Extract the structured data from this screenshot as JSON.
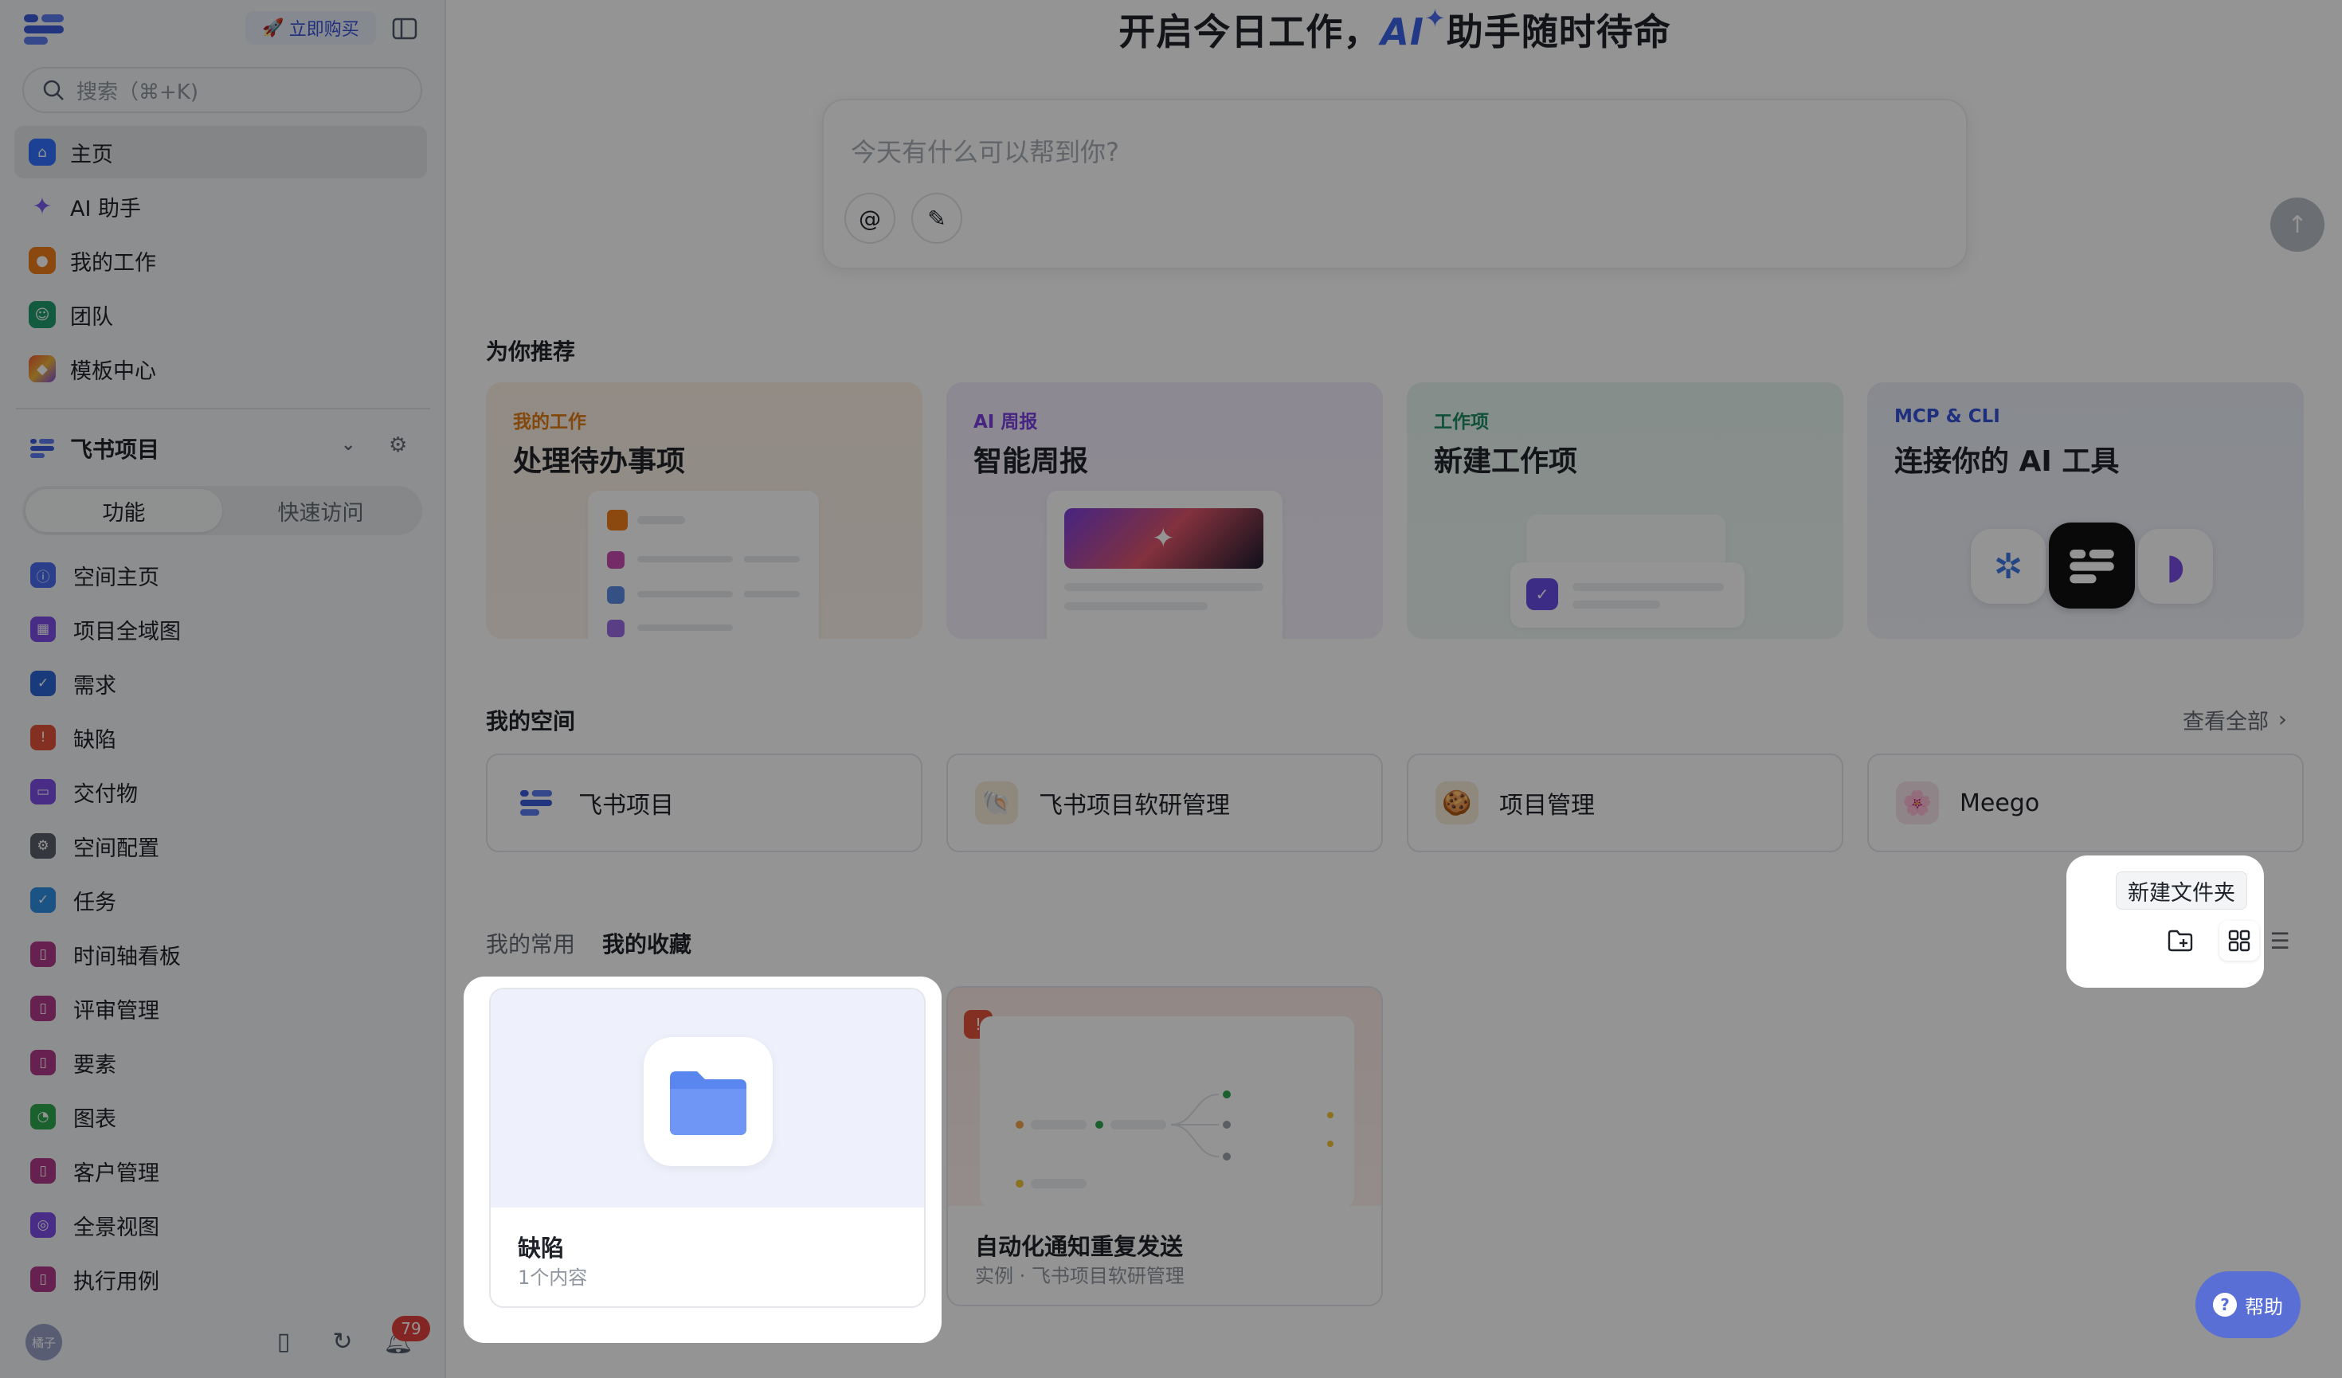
{
  "sidebar": {
    "buy_label": "立即购买",
    "search_placeholder": "搜索（⌘+K)",
    "nav": [
      {
        "label": "主页",
        "color": "#3370ff",
        "icon": "home-icon"
      },
      {
        "label": "AI 助手",
        "color": "#7b5cf0",
        "icon": "sparkle-icon"
      },
      {
        "label": "我的工作",
        "color": "#f07c1a",
        "icon": "person-icon"
      },
      {
        "label": "团队",
        "color": "#1f9c6e",
        "icon": "team-icon"
      },
      {
        "label": "模板中心",
        "color": "#f05a3a",
        "icon": "template-icon"
      }
    ],
    "project": {
      "name": "飞书项目"
    },
    "segments": [
      "功能",
      "快速访问"
    ],
    "functions": [
      {
        "label": "空间主页",
        "color": "#4a6cf0"
      },
      {
        "label": "项目全域图",
        "color": "#7c4de6"
      },
      {
        "label": "需求",
        "color": "#2b66d6"
      },
      {
        "label": "缺陷",
        "color": "#e2513a"
      },
      {
        "label": "交付物",
        "color": "#7c4de6"
      },
      {
        "label": "空间配置",
        "color": "#5a5f69"
      },
      {
        "label": "任务",
        "color": "#2f8fe6"
      },
      {
        "label": "时间轴看板",
        "color": "#b03a8c"
      },
      {
        "label": "评审管理",
        "color": "#b03a8c"
      },
      {
        "label": "要素",
        "color": "#b03a8c"
      },
      {
        "label": "图表",
        "color": "#2fa84f"
      },
      {
        "label": "客户管理",
        "color": "#b03a8c"
      },
      {
        "label": "全景视图",
        "color": "#7c4de6"
      },
      {
        "label": "执行用例",
        "color": "#b03a8c"
      }
    ],
    "avatar_text": "橘子",
    "notification_count": "79"
  },
  "main": {
    "headline_pre": "开启今日工作，",
    "headline_ai": "AI",
    "headline_post": "助手随时待命",
    "chat_placeholder": "今天有什么可以帮到你?",
    "recommend_title": "为你推荐",
    "recommend": [
      {
        "tag": "我的工作",
        "title": "处理待办事项",
        "tag_color": "#e07a12"
      },
      {
        "tag": "AI 周报",
        "title": "智能周报",
        "tag_color": "#7a3fe0"
      },
      {
        "tag": "工作项",
        "title": "新建工作项",
        "tag_color": "#1b8a63"
      },
      {
        "tag": "MCP & CLI",
        "title": "连接你的 AI 工具",
        "tag_color": "#3452d9"
      }
    ],
    "spaces_title": "我的空间",
    "view_all": "查看全部",
    "spaces": [
      {
        "name": "飞书项目"
      },
      {
        "name": "飞书项目软研管理"
      },
      {
        "name": "项目管理"
      },
      {
        "name": "Meego"
      }
    ],
    "tabs": [
      "我的常用",
      "我的收藏"
    ],
    "tooltip": "新建文件夹",
    "favorites": [
      {
        "name": "缺陷",
        "sub": "1个内容"
      },
      {
        "name": "自动化通知重复发送",
        "sub": "实例 · 飞书项目软研管理"
      }
    ],
    "help_label": "帮助"
  }
}
